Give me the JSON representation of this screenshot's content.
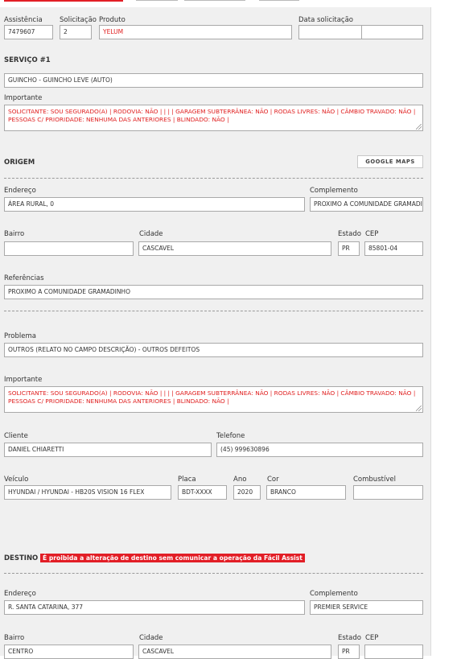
{
  "top": {
    "assistencia_label": "Assistência",
    "assistencia_value": "7479607",
    "solicitacao_label": "Solicitação",
    "solicitacao_value": "2",
    "produto_label": "Produto",
    "produto_value": "YELUM",
    "data_label": "Data solicitação",
    "data_value": "",
    "hora_value": ""
  },
  "service": {
    "title": "SERVIÇO #1",
    "type_value": "GUINCHO - GUINCHO LEVE (AUTO)",
    "importante_label": "Importante",
    "importante_text": "SOLICITANTE: SOU SEGURADO(A) | RODOVIA: NÃO |  |  |  | GARAGEM SUBTERRÂNEA: NÃO | RODAS LIVRES: NÃO | CÂMBIO TRAVADO: NÃO | PESSOAS C/ PRIORIDADE: NENHUMA DAS ANTERIORES | BLINDADO: NÃO |"
  },
  "origem": {
    "title": "ORIGEM",
    "maps_button": "GOOGLE MAPS",
    "endereco_label": "Endereço",
    "endereco_value": "ÁREA RURAL, 0",
    "complemento_label": "Complemento",
    "complemento_value": "PROXIMO  A COMUNIDADE GRAMADI",
    "bairro_label": "Bairro",
    "bairro_value": "",
    "cidade_label": "Cidade",
    "cidade_value": "CASCAVEL",
    "estado_label": "Estado",
    "estado_value": "PR",
    "cep_label": "CEP",
    "cep_value": "85801-04",
    "referencias_label": "Referências",
    "referencias_value": "PROXIMO  A COMUNIDADE GRAMADINHO"
  },
  "problema": {
    "label": "Problema",
    "value": "OUTROS (RELATO NO CAMPO DESCRIÇÃO) - OUTROS DEFEITOS",
    "importante_label": "Importante",
    "importante_text": "SOLICITANTE: SOU SEGURADO(A) | RODOVIA: NÃO |  |  |  | GARAGEM SUBTERRÂNEA: NÃO | RODAS LIVRES: NÃO | CÂMBIO TRAVADO: NÃO | PESSOAS C/ PRIORIDADE: NENHUMA DAS ANTERIORES | BLINDADO: NÃO |"
  },
  "cliente": {
    "cliente_label": "Cliente",
    "cliente_value": "DANIEL CHIARETTI",
    "telefone_label": "Telefone",
    "telefone_value": "(45) 999630896"
  },
  "veiculo": {
    "veiculo_label": "Veículo",
    "veiculo_value": "HYUNDAI / HYUNDAI - HB20S VISION 16 FLEX",
    "placa_label": "Placa",
    "placa_value": "BDT-XXXX",
    "ano_label": "Ano",
    "ano_value": "2020",
    "cor_label": "Cor",
    "cor_value": "BRANCO",
    "combustivel_label": "Combustível",
    "combustivel_value": ""
  },
  "destino": {
    "title": "DESTINO",
    "warning": "É proibida a alteração de destino sem comunicar a operação da Fácil Assist",
    "endereco_label": "Endereço",
    "endereco_value": "R. SANTA CATARINA, 377",
    "complemento_label": "Complemento",
    "complemento_value": "PREMIER SERVICE",
    "bairro_label": "Bairro",
    "bairro_value": "CENTRO",
    "cidade_label": "Cidade",
    "cidade_value": "CASCAVEL",
    "estado_label": "Estado",
    "estado_value": "PR",
    "cep_label": "CEP",
    "cep_value": ""
  },
  "colors": {
    "accent": "#e21e26",
    "panel_bg": "#f0f0f0",
    "alert_text": "#e02020"
  }
}
